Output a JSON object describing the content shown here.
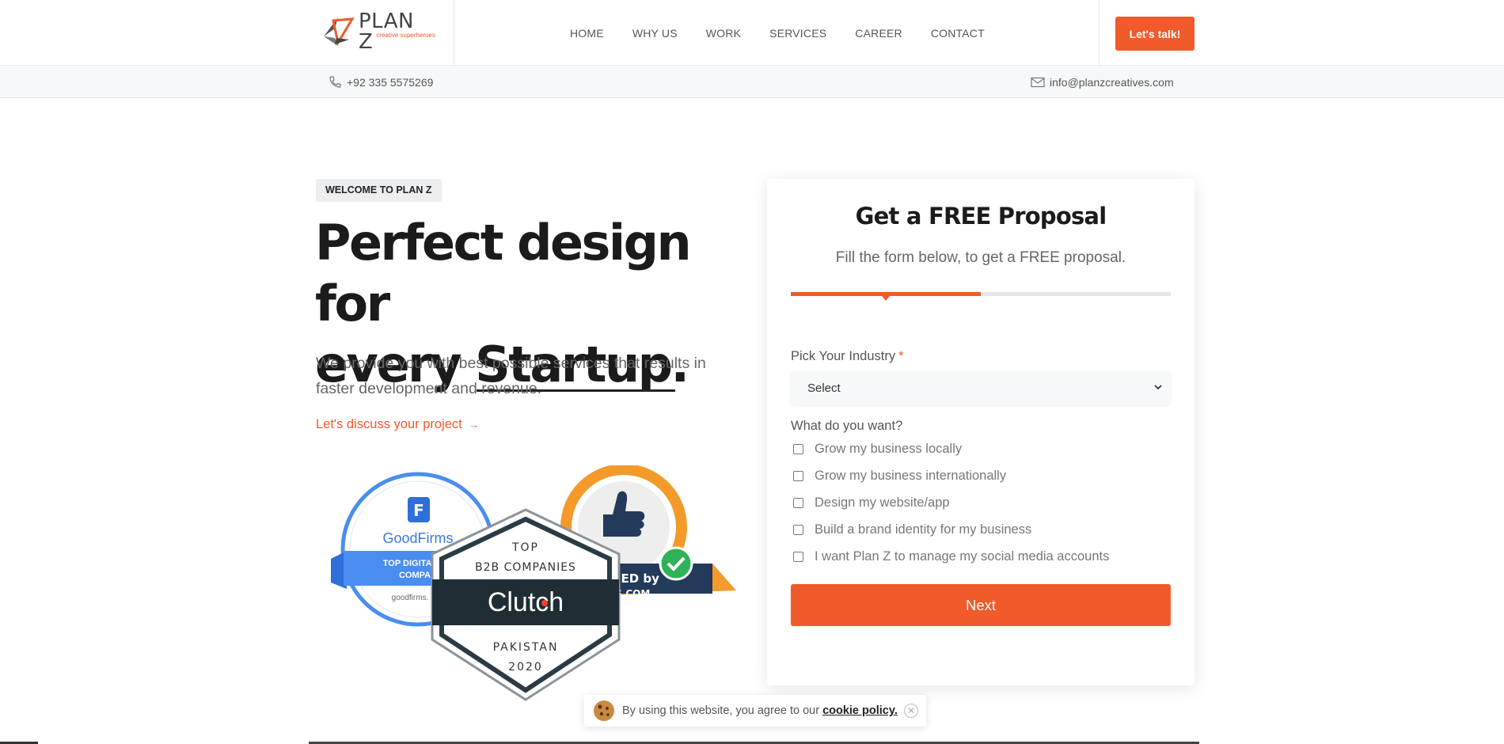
{
  "brand": {
    "name": "PLAN Z",
    "tagline": "creative superheroes",
    "accent_color": "#f15a2b"
  },
  "nav": {
    "items": [
      {
        "label": "HOME"
      },
      {
        "label": "WHY US"
      },
      {
        "label": "WORK"
      },
      {
        "label": "SERVICES"
      },
      {
        "label": "CAREER"
      },
      {
        "label": "CONTACT"
      }
    ],
    "cta_label": "Let's talk!"
  },
  "topbar": {
    "phone": "+92 335 5575269",
    "email": "info@planzcreatives.com"
  },
  "hero": {
    "badge": "WELCOME TO PLAN Z",
    "title_line1": "Perfect design for",
    "title_line2_prefix": "every",
    "title_highlight": "Startup",
    "title_suffix": ".",
    "description": "We provide you with best possible services that results in faster development and revenue.",
    "link_label": "Let's discuss your project",
    "link_arrow": "→"
  },
  "awards": {
    "goodfirms": {
      "name": "GoodFirms",
      "ribbon_line1": "TOP DIGITAL MA",
      "ribbon_line2": "COMPAN",
      "site": "goodfirms."
    },
    "clutch": {
      "top": "TOP",
      "category": "B2B COMPANIES",
      "name": "Clutch",
      "country": "PAKISTAN",
      "year": "2020"
    },
    "verified": {
      "line1": "IFIED by",
      "line2": "EOS.COM"
    }
  },
  "form": {
    "title": "Get a FREE Proposal",
    "subtitle": "Fill the form below, to get a FREE proposal.",
    "progress": 0.5,
    "industry_label": "Pick Your Industry",
    "required_mark": "*",
    "industry_selected": "Select",
    "want_label": "What do you want?",
    "options": [
      {
        "label": "Grow my business locally",
        "checked": false
      },
      {
        "label": "Grow my business internationally",
        "checked": false
      },
      {
        "label": "Design my website/app",
        "checked": false
      },
      {
        "label": "Build a brand identity for my business",
        "checked": false
      },
      {
        "label": "I want Plan Z to manage my social media accounts",
        "checked": false
      }
    ],
    "next_label": "Next"
  },
  "cookie": {
    "text": "By using this website, you agree to our",
    "link_label": "cookie policy.",
    "close_glyph": "✕"
  }
}
